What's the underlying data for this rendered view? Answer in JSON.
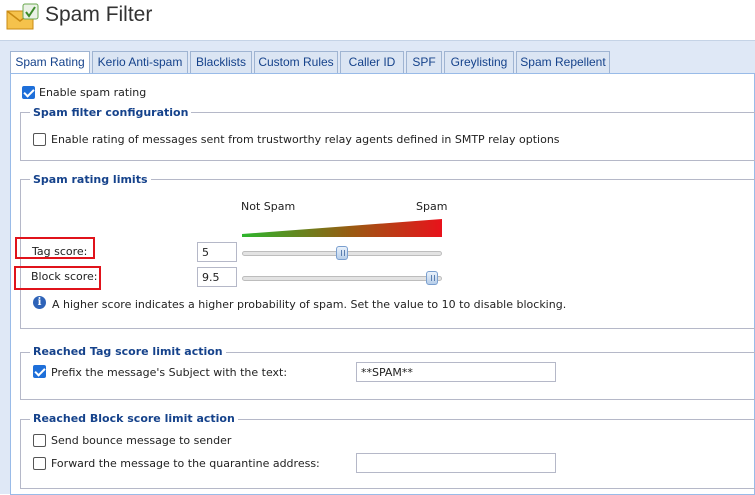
{
  "header": {
    "title": "Spam Filter",
    "icon": "envelope-filter-icon"
  },
  "tabs": [
    {
      "label": "Spam Rating",
      "active": true
    },
    {
      "label": "Kerio Anti-spam",
      "active": false
    },
    {
      "label": "Blacklists",
      "active": false
    },
    {
      "label": "Custom Rules",
      "active": false
    },
    {
      "label": "Caller ID",
      "active": false
    },
    {
      "label": "SPF",
      "active": false
    },
    {
      "label": "Greylisting",
      "active": false
    },
    {
      "label": "Spam Repellent",
      "active": false
    }
  ],
  "enable_rating": {
    "label": "Enable spam rating",
    "checked": true
  },
  "config": {
    "legend": "Spam filter configuration",
    "relay_option": {
      "label": "Enable rating of messages sent from trustworthy relay agents defined in SMTP relay options",
      "checked": false
    }
  },
  "limits": {
    "legend": "Spam rating limits",
    "scale_left": "Not Spam",
    "scale_right": "Spam",
    "tag": {
      "label": "Tag score:",
      "value": "5",
      "slider_fraction": 0.5
    },
    "block": {
      "label": "Block score:",
      "value": "9.5",
      "slider_fraction": 0.95
    },
    "info": "A higher score indicates a higher probability of spam. Set the value to 10 to disable blocking.",
    "colors": {
      "gradient_start": "#2db52d",
      "gradient_end": "#e8121b",
      "highlight": "#e0131b"
    }
  },
  "tag_action": {
    "legend": "Reached Tag score limit action",
    "prefix": {
      "label": "Prefix the message's Subject with the text:",
      "checked": true,
      "value": "**SPAM**"
    }
  },
  "block_action": {
    "legend": "Reached Block score limit action",
    "bounce": {
      "label": "Send bounce message to sender",
      "checked": false
    },
    "forward": {
      "label": "Forward the message to the quarantine address:",
      "checked": false,
      "value": ""
    }
  }
}
